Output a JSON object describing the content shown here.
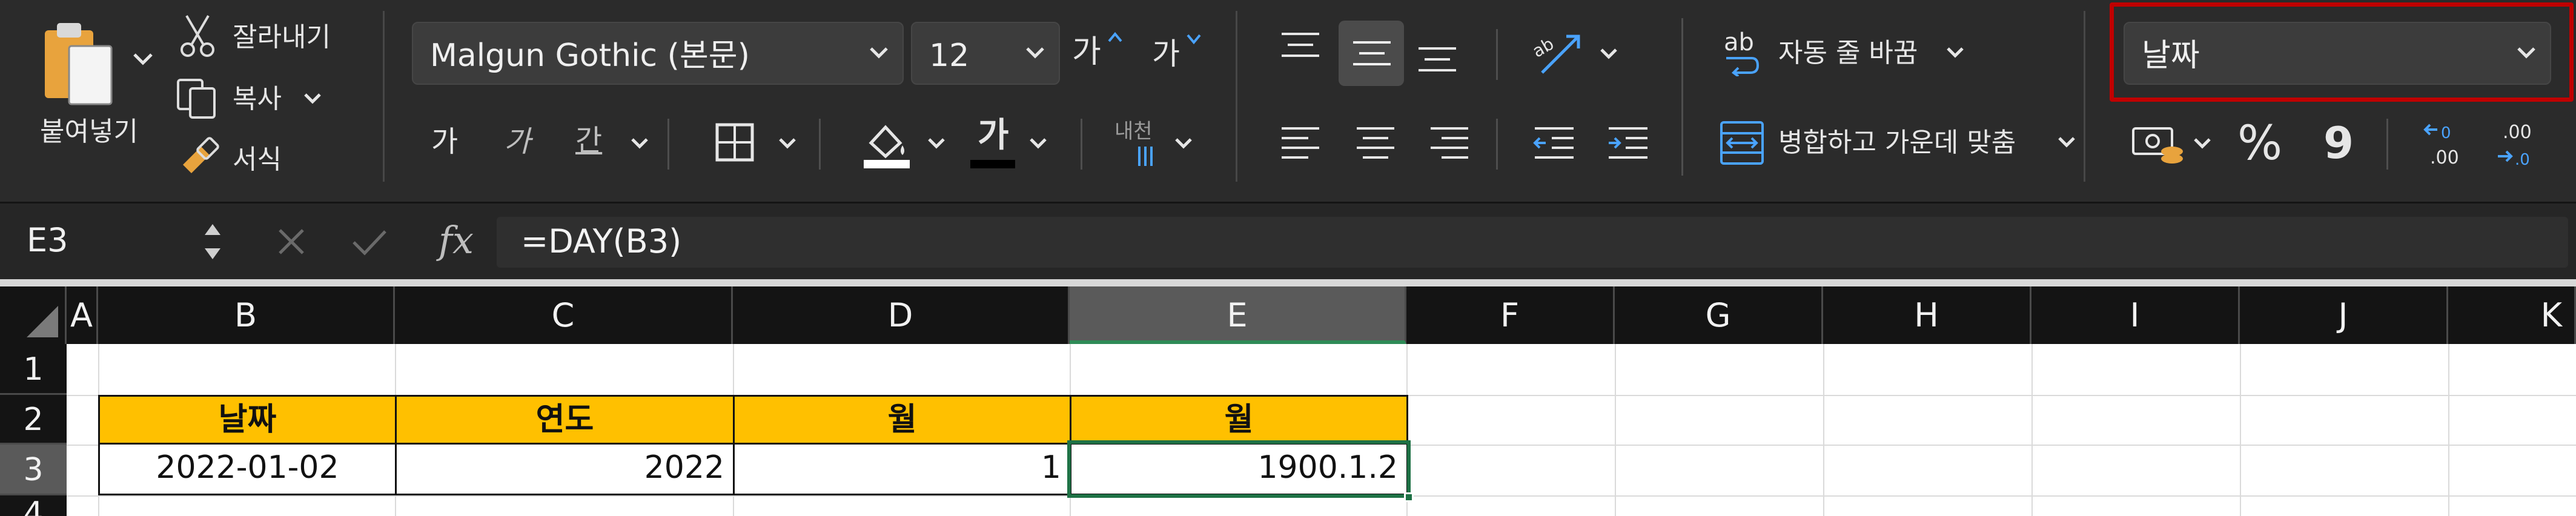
{
  "clipboard": {
    "paste_label": "붙여넣기",
    "cut_label": "잘라내기",
    "copy_label": "복사",
    "format_painter_label": "서식"
  },
  "font": {
    "family": "Malgun Gothic (본문)",
    "size": "12",
    "increase_label": "가",
    "decrease_label": "가",
    "bold_label": "가",
    "italic_label": "가",
    "underline_label": "간",
    "font_color_label": "가",
    "phonetic_label": "내천"
  },
  "alignment": {
    "wrap_text_label": "자동 줄 바꿈",
    "merge_center_label": "병합하고 가운데 맞춤",
    "orientation_label": "ab"
  },
  "number": {
    "format_value": "날짜",
    "percent_label": "%",
    "comma_label": "9",
    "increase_decimal_label": ".00",
    "decrease_decimal_label": ".00"
  },
  "formula_bar": {
    "name_box": "E3",
    "fx_label": "fx",
    "formula": "=DAY(B3)"
  },
  "sheet": {
    "columns": [
      "A",
      "B",
      "C",
      "D",
      "E",
      "F",
      "G",
      "H",
      "I",
      "J",
      "K"
    ],
    "rows": [
      "1",
      "2",
      "3",
      "4"
    ],
    "headers": [
      "날짜",
      "연도",
      "월",
      "월"
    ],
    "row3": [
      "2022-01-02",
      "2022",
      "1",
      "1900.1.2"
    ]
  },
  "colors": {
    "header_fill": "#ffc000",
    "selection": "#1e7145",
    "highlight_box": "#c00000"
  }
}
